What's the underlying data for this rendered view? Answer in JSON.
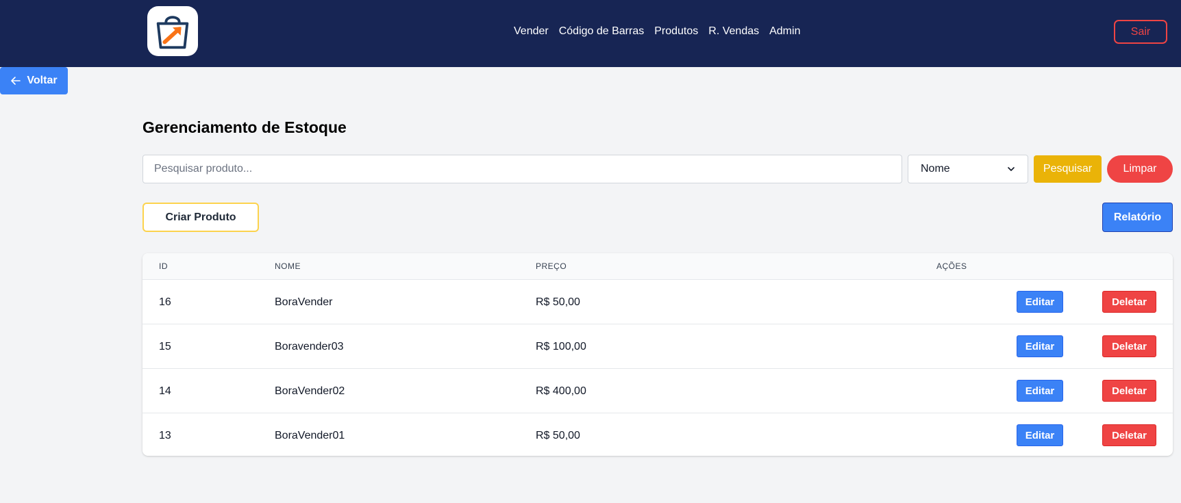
{
  "nav": {
    "links": [
      "Vender",
      "Código de Barras",
      "Produtos",
      "R. Vendas",
      "Admin"
    ],
    "logout_label": "Sair"
  },
  "back_label": "Voltar",
  "page_title": "Gerenciamento de Estoque",
  "search": {
    "placeholder": "Pesquisar produto...",
    "value": "",
    "filter_selected": "Nome",
    "search_label": "Pesquisar",
    "clear_label": "Limpar"
  },
  "actions": {
    "create_label": "Criar Produto",
    "report_label": "Relatório"
  },
  "table": {
    "headers": [
      "ID",
      "Nome",
      "Preço",
      "Ações"
    ],
    "edit_label": "Editar",
    "delete_label": "Deletar",
    "rows": [
      {
        "id": "16",
        "name": "BoraVender",
        "price": "R$ 50,00"
      },
      {
        "id": "15",
        "name": "Boravender03",
        "price": "R$ 100,00"
      },
      {
        "id": "14",
        "name": "BoraVender02",
        "price": "R$ 400,00"
      },
      {
        "id": "13",
        "name": "BoraVender01",
        "price": "R$ 50,00"
      }
    ]
  },
  "colors": {
    "navbar": "#172554",
    "primary": "#3b82f6",
    "danger": "#ef4444",
    "warning": "#eab308",
    "page_bg": "#f3f4f6"
  },
  "icons": {
    "logo": "shopping-bag-arrow-icon",
    "back": "arrow-left-icon",
    "select": "chevron-down-icon"
  }
}
